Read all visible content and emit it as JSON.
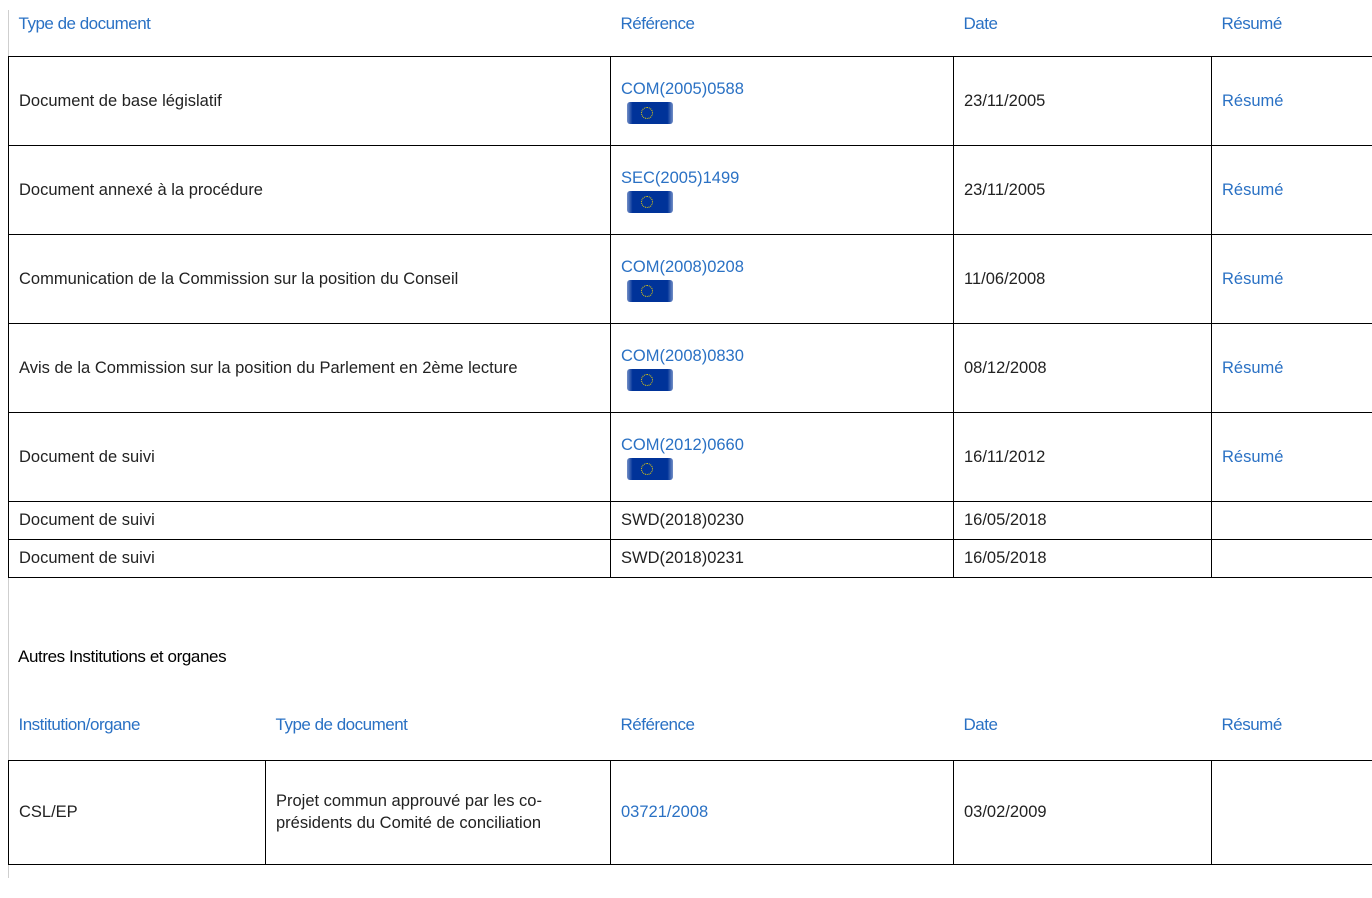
{
  "main_table": {
    "headers": [
      "Type de document",
      "Référence",
      "Date",
      "Résumé"
    ],
    "rows": [
      {
        "type": "Document de base législatif",
        "reference": "COM(2005)0588",
        "ref_link": true,
        "flag": true,
        "date": "23/11/2005",
        "summary": "Résumé"
      },
      {
        "type": "Document annexé à la procédure",
        "reference": "SEC(2005)1499",
        "ref_link": true,
        "flag": true,
        "date": "23/11/2005",
        "summary": "Résumé"
      },
      {
        "type": "Communication de la Commission sur la position du Conseil",
        "reference": "COM(2008)0208",
        "ref_link": true,
        "flag": true,
        "date": "11/06/2008",
        "summary": "Résumé"
      },
      {
        "type": "Avis de la Commission sur la position du Parlement en 2ème lecture",
        "reference": "COM(2008)0830",
        "ref_link": true,
        "flag": true,
        "date": "08/12/2008",
        "summary": "Résumé"
      },
      {
        "type": "Document de suivi",
        "reference": "COM(2012)0660",
        "ref_link": true,
        "flag": true,
        "date": "16/11/2012",
        "summary": "Résumé"
      },
      {
        "type": "Document de suivi",
        "reference": "SWD(2018)0230",
        "ref_link": false,
        "flag": false,
        "date": "16/05/2018",
        "summary": ""
      },
      {
        "type": "Document de suivi",
        "reference": "SWD(2018)0231",
        "ref_link": false,
        "flag": false,
        "date": "16/05/2018",
        "summary": ""
      }
    ]
  },
  "other_section": {
    "title": "Autres Institutions et organes",
    "headers": [
      "Institution/organe",
      "Type de document",
      "Référence",
      "Date",
      "Résumé"
    ],
    "rows": [
      {
        "institution": "CSL/EP",
        "type": "Projet commun approuvé par les co-présidents du Comité de conciliation",
        "reference": "03721/2008",
        "date": "03/02/2009",
        "summary": ""
      }
    ]
  },
  "colors": {
    "link": "#2a71c4",
    "flag": "#003399",
    "text": "#222222"
  },
  "icons": {
    "flag": "eu-flag-icon"
  }
}
